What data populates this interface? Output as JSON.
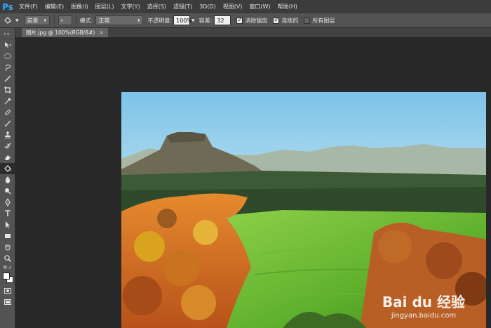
{
  "app": {
    "logo": "Ps"
  },
  "menu": [
    "文件(F)",
    "编辑(E)",
    "图像(I)",
    "图层(L)",
    "文字(Y)",
    "选择(S)",
    "滤镜(T)",
    "3D(D)",
    "视图(V)",
    "窗口(W)",
    "帮助(H)"
  ],
  "options": {
    "fill_source": "前景",
    "mode_label": "模式:",
    "mode_value": "正常",
    "opacity_label": "不透明度:",
    "opacity_value": "100%",
    "tolerance_label": "容差:",
    "tolerance_value": "32",
    "antialias_label": "消除锯齿",
    "antialias_checked": true,
    "contiguous_label": "连续的",
    "contiguous_checked": true,
    "all_layers_label": "所有图层",
    "all_layers_checked": false
  },
  "document_tab": {
    "title": "图片.jpg @ 100%(RGB/8#)",
    "close": "×"
  },
  "tools": [
    "move-icon",
    "marquee-icon",
    "lasso-icon",
    "magic-wand-icon",
    "crop-icon",
    "eyedropper-icon",
    "healing-brush-icon",
    "brush-icon",
    "clone-stamp-icon",
    "history-brush-icon",
    "eraser-icon",
    "paint-bucket-icon",
    "blur-icon",
    "dodge-icon",
    "pen-icon",
    "type-icon",
    "path-selection-icon",
    "rectangle-icon",
    "hand-icon",
    "zoom-icon"
  ],
  "active_tool": "paint-bucket-icon",
  "watermark": {
    "logo": "Bai du 经验",
    "url": "jingyan.baidu.com"
  },
  "colors": {
    "foreground": "#ffffff",
    "background": "#ffffff",
    "accent": "#31a8ff"
  }
}
